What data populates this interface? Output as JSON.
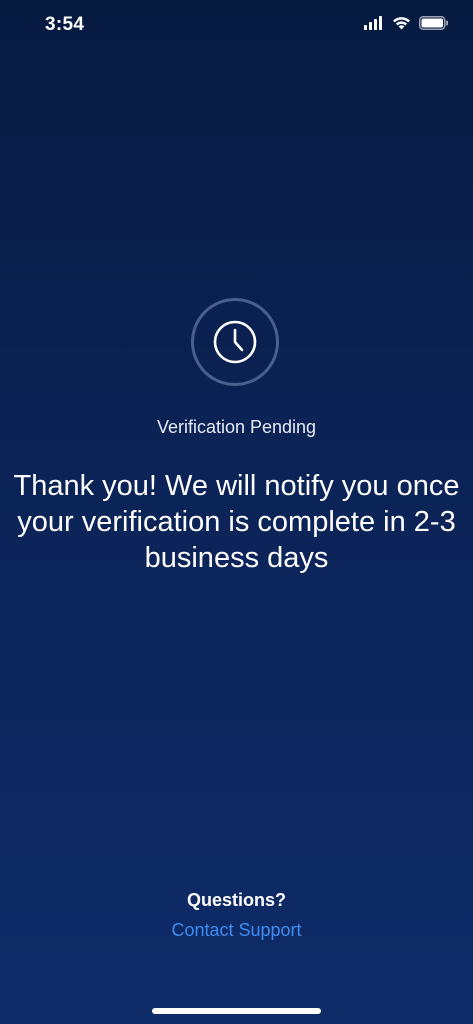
{
  "status_bar": {
    "time": "3:54",
    "icons": [
      "signal-icon",
      "wifi-icon",
      "battery-icon"
    ]
  },
  "pending": {
    "icon": "clock-icon",
    "label": "Verification Pending",
    "message": "Thank you! We will notify you once your verification is complete in 2-3 business days"
  },
  "footer": {
    "questions_label": "Questions?",
    "support_link": "Contact Support"
  },
  "colors": {
    "background_top": "#071a40",
    "background_bottom": "#0f2c69",
    "ring": "#4a5f8c",
    "link": "#3f8cf0",
    "text": "#ffffff"
  }
}
